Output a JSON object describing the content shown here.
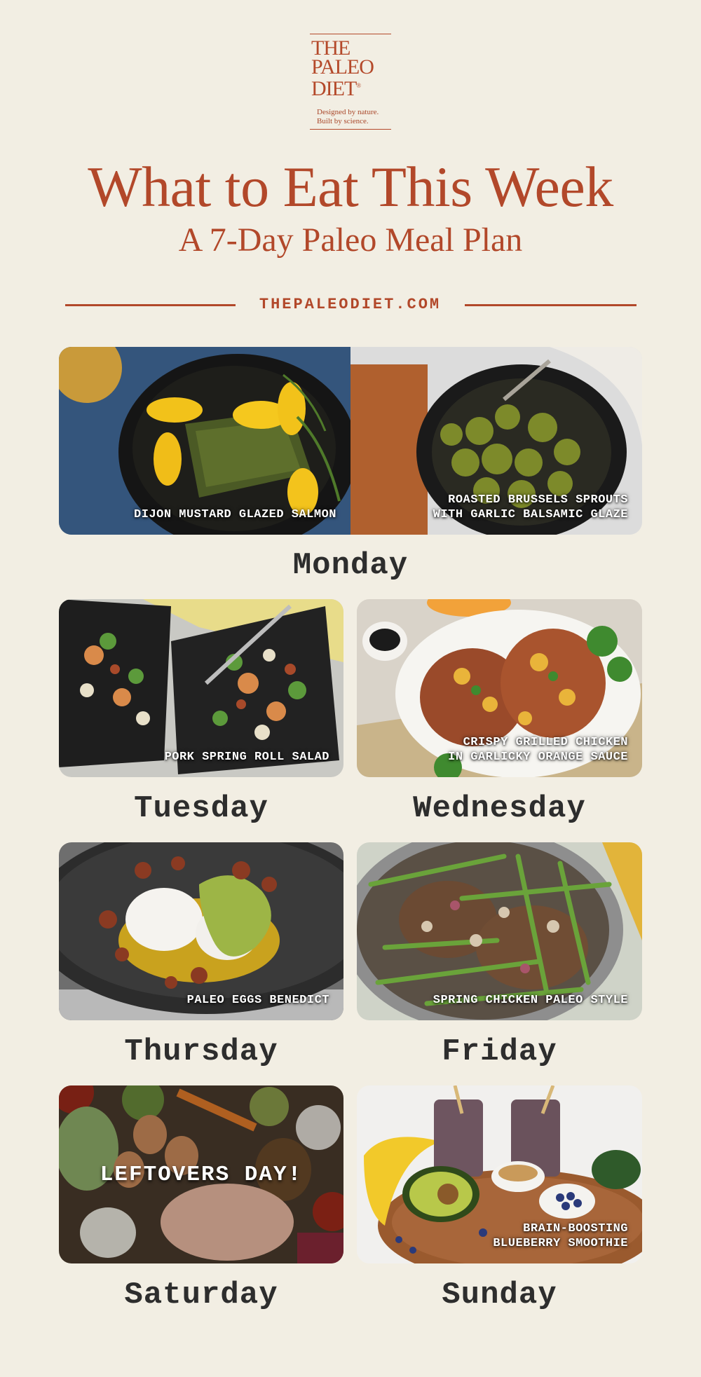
{
  "logo": {
    "line1": "THE",
    "line2": "PALEO",
    "line3": "DIET",
    "reg": "®",
    "tagline1": "Designed by nature.",
    "tagline2": "Built by science."
  },
  "header": {
    "title": "What to Eat This Week",
    "subtitle": "A 7-Day Paleo Meal Plan",
    "site": "THEPALEODIET.COM"
  },
  "colors": {
    "background": "#f2eee3",
    "brand": "#b2482a",
    "day_text": "#2d2d2d"
  },
  "days": {
    "monday": {
      "label": "Monday",
      "meal1": "DIJON MUSTARD GLAZED SALMON",
      "meal2": "ROASTED BRUSSELS SPROUTS\nWITH GARLIC BALSAMIC GLAZE"
    },
    "tuesday": {
      "label": "Tuesday",
      "meal": "PORK SPRING ROLL SALAD"
    },
    "wednesday": {
      "label": "Wednesday",
      "meal": "CRISPY GRILLED CHICKEN\nIN GARLICKY ORANGE SAUCE"
    },
    "thursday": {
      "label": "Thursday",
      "meal": "PALEO EGGS BENEDICT"
    },
    "friday": {
      "label": "Friday",
      "meal": "SPRING CHICKEN PALEO STYLE"
    },
    "saturday": {
      "label": "Saturday",
      "meal": "LEFTOVERS DAY!"
    },
    "sunday": {
      "label": "Sunday",
      "meal": "BRAIN-BOOSTING\nBLUEBERRY SMOOTHIE"
    }
  }
}
